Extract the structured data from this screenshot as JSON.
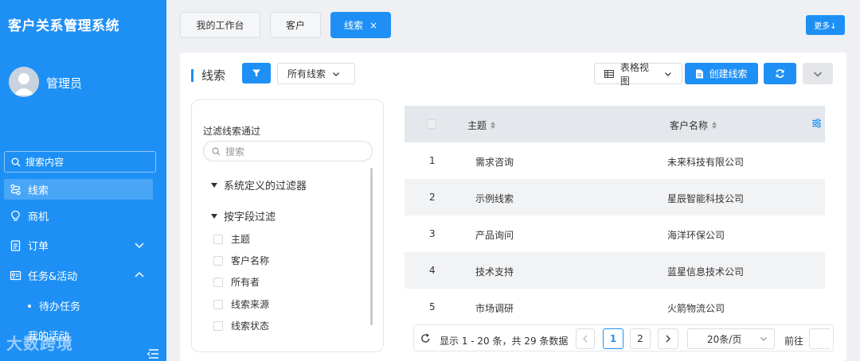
{
  "app": {
    "title": "客户关系管理系统"
  },
  "user": {
    "name": "管理员"
  },
  "sidebar": {
    "search_placeholder": "搜索内容",
    "items": [
      {
        "label": "线索",
        "icon": "route-icon",
        "active": true
      },
      {
        "label": "商机",
        "icon": "lightbulb-icon"
      },
      {
        "label": "订单",
        "icon": "clipboard-icon",
        "expand": "chevron-down"
      },
      {
        "label": "任务&活动",
        "icon": "id-card-icon",
        "expand": "chevron-up"
      }
    ],
    "sub_items": [
      {
        "label": "待办任务"
      },
      {
        "label": "我的活动"
      }
    ],
    "watermark": "大数跨境"
  },
  "tabs": [
    {
      "label": "我的工作台"
    },
    {
      "label": "客户"
    },
    {
      "label": "线索",
      "active": true,
      "close": "×"
    }
  ],
  "more_button": "更多↓",
  "panel": {
    "title": "线索",
    "view_filter": "所有线索",
    "view_mode": "表格视图",
    "create_button": "创建线索"
  },
  "filter": {
    "title": "过滤线索通过",
    "search_placeholder": "搜索",
    "sections": [
      "系统定义的过滤器",
      "按字段过滤"
    ],
    "fields": [
      "主题",
      "客户名称",
      "所有者",
      "线索来源",
      "线索状态"
    ]
  },
  "table": {
    "columns": [
      "主题",
      "客户名称"
    ],
    "rows": [
      {
        "index": "1",
        "subject": "需求咨询",
        "customer": "未来科技有限公司"
      },
      {
        "index": "2",
        "subject": "示例线索",
        "customer": "星辰智能科技公司"
      },
      {
        "index": "3",
        "subject": "产品询问",
        "customer": "海洋环保公司"
      },
      {
        "index": "4",
        "subject": "技术支持",
        "customer": "蓝星信息技术公司"
      },
      {
        "index": "5",
        "subject": "市场调研",
        "customer": "火箭物流公司"
      }
    ]
  },
  "pagination": {
    "summary": "显示 1 - 20 条，共 29 条数据",
    "pages": [
      "1",
      "2"
    ],
    "current": "1",
    "page_size": "20条/页",
    "goto_label": "前往"
  },
  "colors": {
    "primary": "#1e90f5",
    "sidebar": "#1e90f5",
    "row_alt": "#f2f3f5"
  }
}
